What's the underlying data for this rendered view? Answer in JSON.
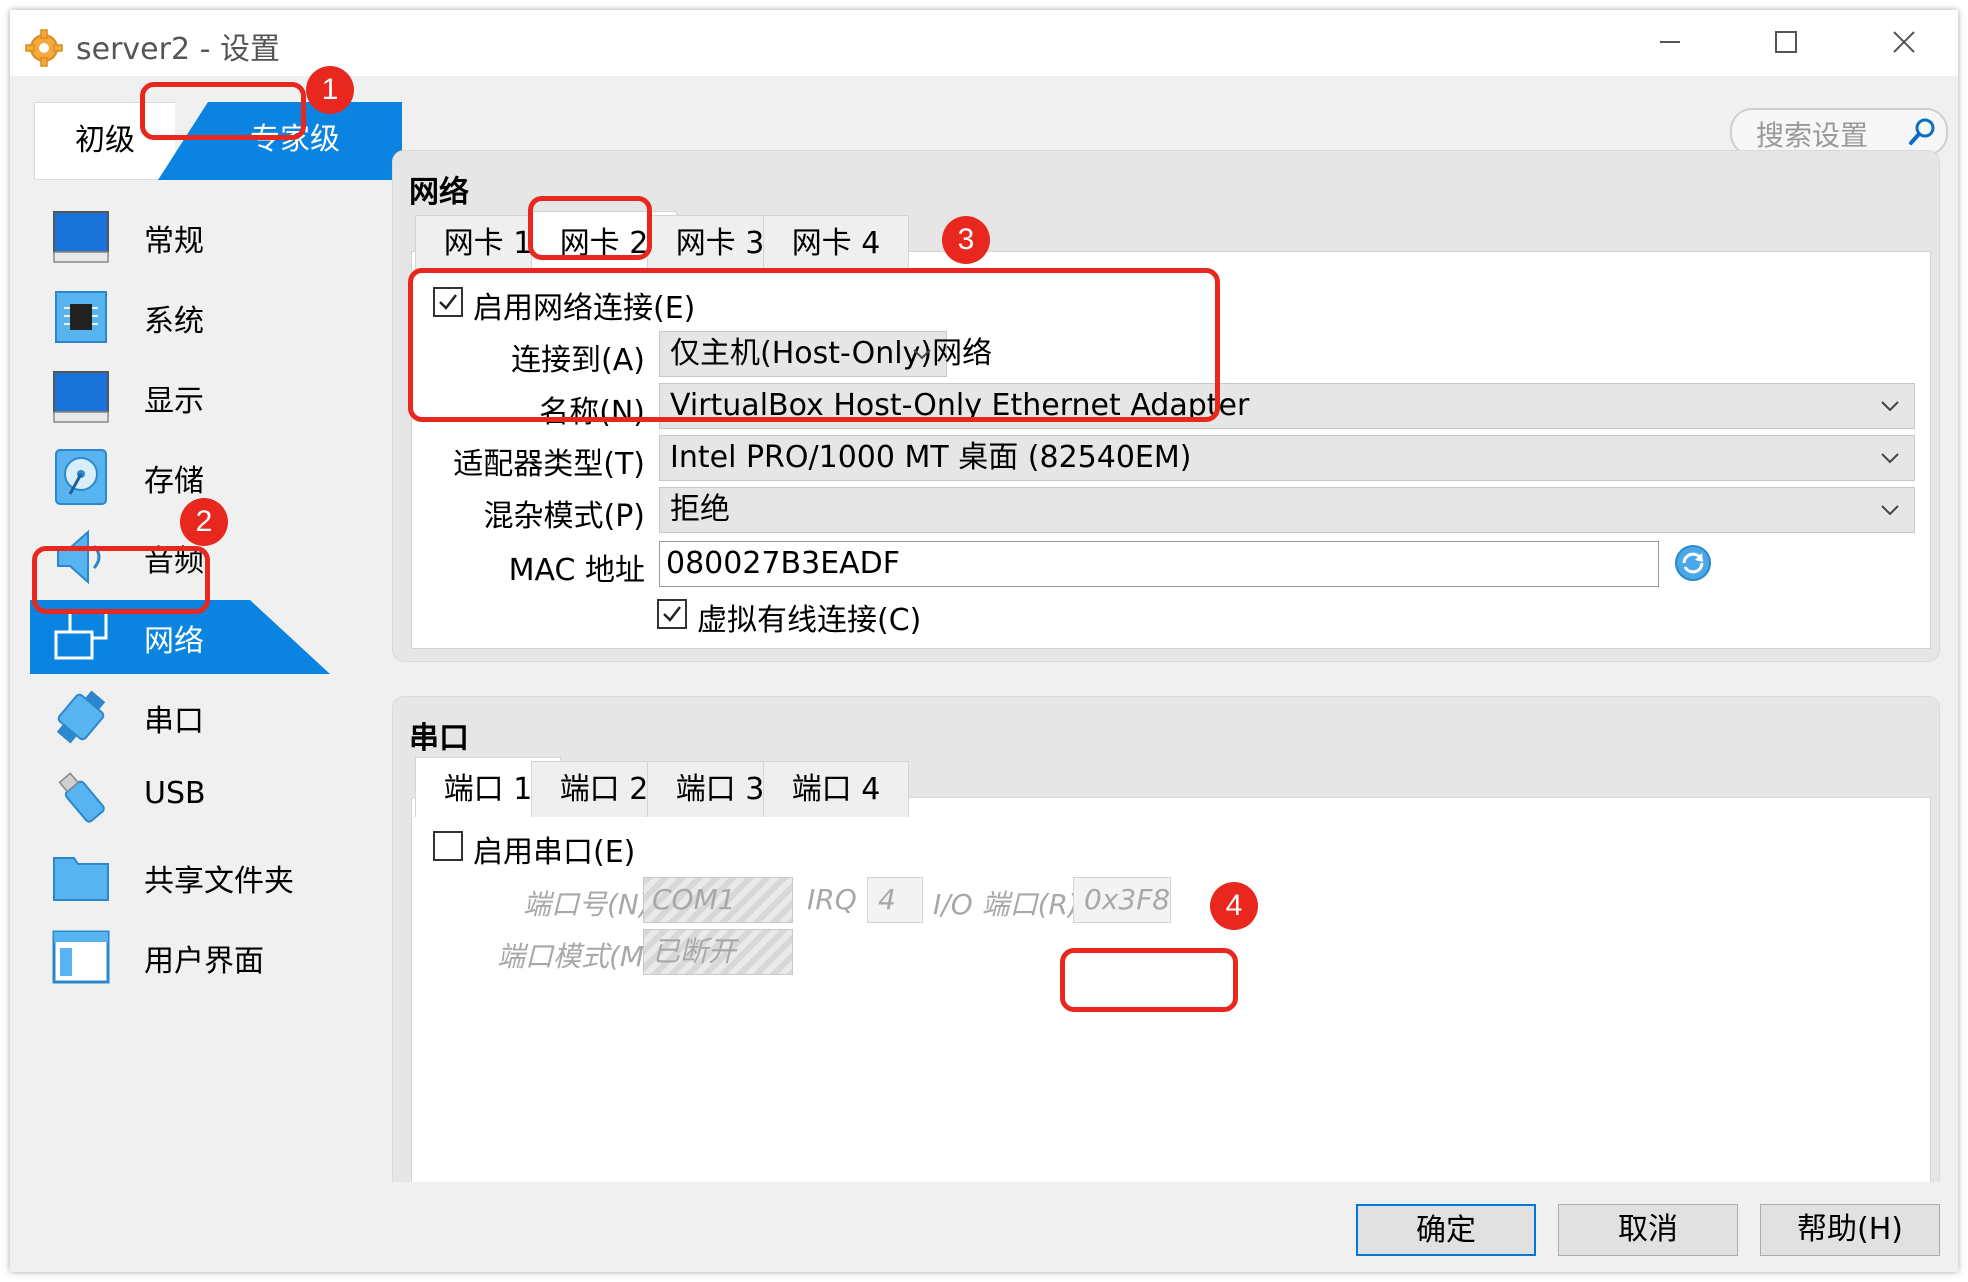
{
  "window": {
    "title": "server2 - 设置"
  },
  "mode_tabs": {
    "basic": "初级",
    "expert": "专家级"
  },
  "search": {
    "placeholder": "搜索设置"
  },
  "sidebar": {
    "items": [
      {
        "label": "常规",
        "icon": "monitor-icon"
      },
      {
        "label": "系统",
        "icon": "chip-icon"
      },
      {
        "label": "显示",
        "icon": "display-icon"
      },
      {
        "label": "存储",
        "icon": "disk-icon"
      },
      {
        "label": "音频",
        "icon": "speaker-icon"
      },
      {
        "label": "网络",
        "icon": "network-icon",
        "active": true
      },
      {
        "label": "串口",
        "icon": "serial-icon"
      },
      {
        "label": "USB",
        "icon": "usb-icon"
      },
      {
        "label": "共享文件夹",
        "icon": "folder-icon"
      },
      {
        "label": "用户界面",
        "icon": "ui-icon"
      }
    ]
  },
  "network": {
    "title": "网络",
    "tabs": [
      "网卡 1",
      "网卡 2",
      "网卡 3",
      "网卡 4"
    ],
    "selected_tab": "网卡 2",
    "enable_label": "启用网络连接(E)",
    "enable_checked": true,
    "attached_label": "连接到(A)",
    "attached_value": "仅主机(Host-Only)网络",
    "name_label": "名称(N)",
    "name_value": "VirtualBox Host-Only Ethernet Adapter",
    "adapter_label": "适配器类型(T)",
    "adapter_value": "Intel PRO/1000 MT 桌面 (82540EM)",
    "promisc_label": "混杂模式(P)",
    "promisc_value": "拒绝",
    "mac_label": "MAC 地址",
    "mac_value": "080027B3EADF",
    "cable_label": "虚拟有线连接(C)",
    "cable_checked": true
  },
  "serial": {
    "title": "串口",
    "tabs": [
      "端口 1",
      "端口 2",
      "端口 3",
      "端口 4"
    ],
    "selected_tab": "端口 1",
    "enable_label": "启用串口(E)",
    "enable_checked": false,
    "port_num_label": "端口号(N)",
    "port_num_value": "COM1",
    "irq_label": "IRQ",
    "irq_value": "4",
    "io_label": "I/O 端口(R)",
    "io_value": "0x3F8",
    "mode_label": "端口模式(M)",
    "mode_value": "已断开"
  },
  "buttons": {
    "ok": "确定",
    "cancel": "取消",
    "help": "帮助(H)"
  },
  "annotations": {
    "b1": "1",
    "b2": "2",
    "b3": "3",
    "b4": "4"
  },
  "colors": {
    "accent": "#0078d7",
    "highlight": "#e8281e"
  }
}
